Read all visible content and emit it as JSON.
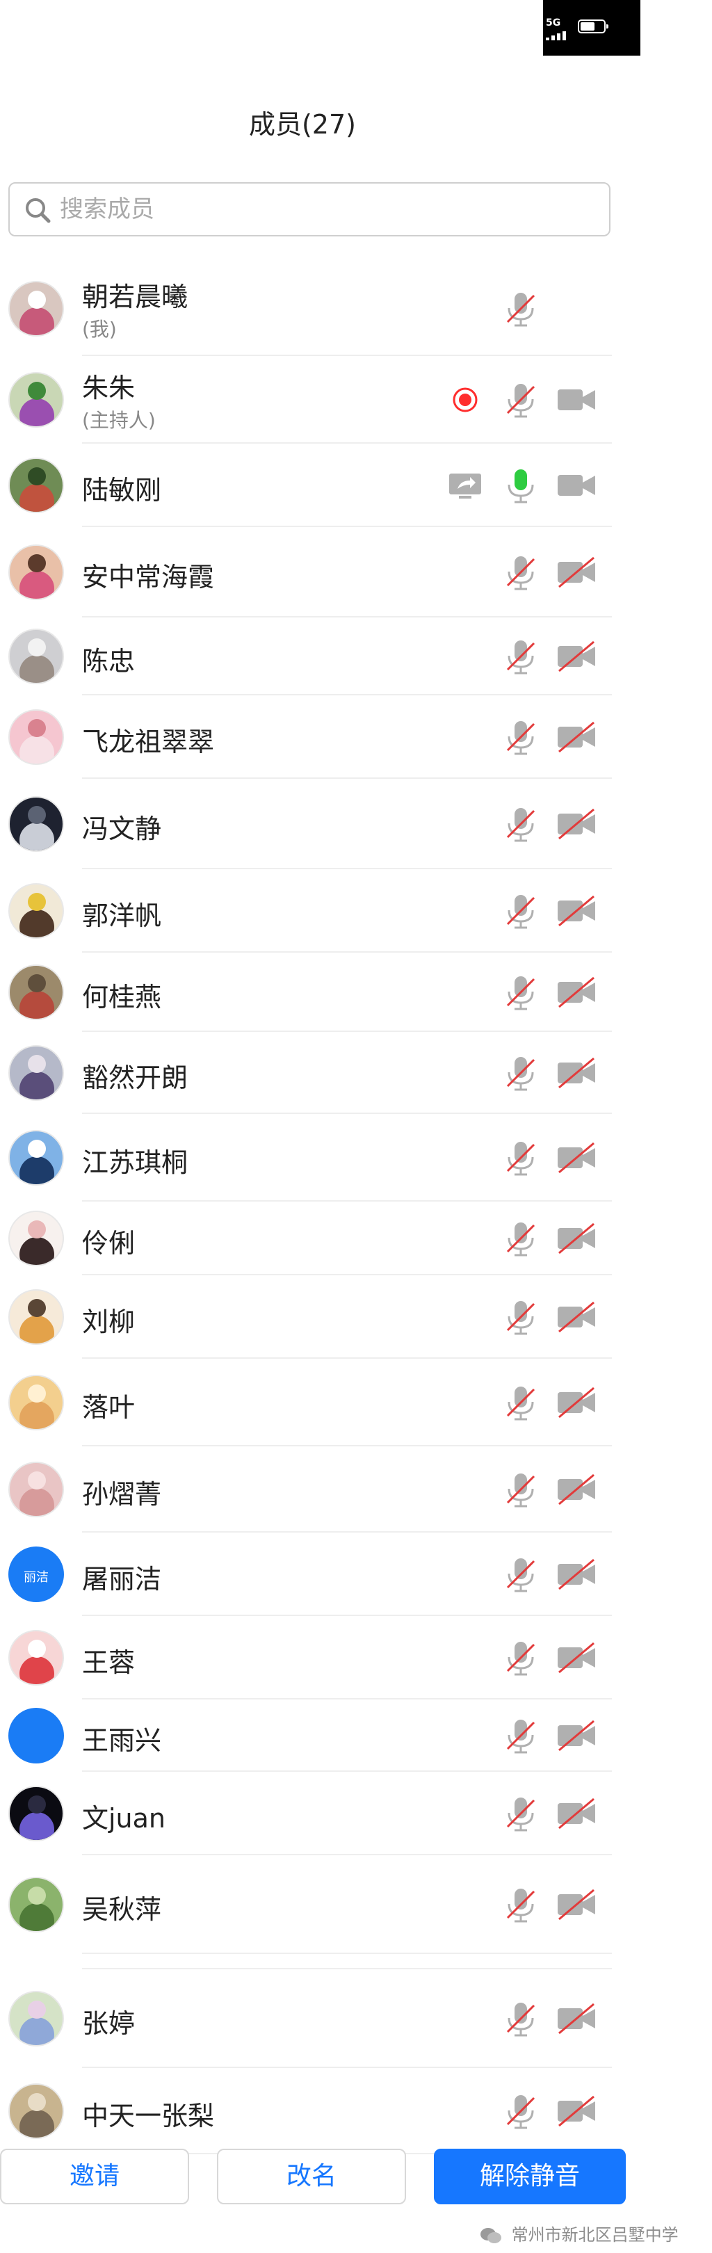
{
  "status_bar": {
    "network": "5G"
  },
  "title": "成员(27)",
  "search": {
    "placeholder": "搜索成员",
    "value": ""
  },
  "members": [
    {
      "name": "朝若晨曦",
      "role": "(我)",
      "mic": "muted",
      "cam": "none",
      "record": false,
      "share": false,
      "avatar": "photo"
    },
    {
      "name": "朱朱",
      "role": "(主持人)",
      "mic": "muted",
      "cam": "on",
      "record": true,
      "share": false,
      "avatar": "photo"
    },
    {
      "name": "陆敏刚",
      "role": "",
      "mic": "active",
      "cam": "on",
      "record": false,
      "share": true,
      "avatar": "photo"
    },
    {
      "name": "安中常海霞",
      "role": "",
      "mic": "muted",
      "cam": "off",
      "record": false,
      "share": false,
      "avatar": "photo"
    },
    {
      "name": "陈忠",
      "role": "",
      "mic": "muted",
      "cam": "off",
      "record": false,
      "share": false,
      "avatar": "photo"
    },
    {
      "name": "飞龙祖翠翠",
      "role": "",
      "mic": "muted",
      "cam": "off",
      "record": false,
      "share": false,
      "avatar": "photo"
    },
    {
      "name": "冯文静",
      "role": "",
      "mic": "muted",
      "cam": "off",
      "record": false,
      "share": false,
      "avatar": "photo"
    },
    {
      "name": "郭洋帆",
      "role": "",
      "mic": "muted",
      "cam": "off",
      "record": false,
      "share": false,
      "avatar": "photo"
    },
    {
      "name": "何桂燕",
      "role": "",
      "mic": "muted",
      "cam": "off",
      "record": false,
      "share": false,
      "avatar": "photo"
    },
    {
      "name": "豁然开朗",
      "role": "",
      "mic": "muted",
      "cam": "off",
      "record": false,
      "share": false,
      "avatar": "photo"
    },
    {
      "name": "江苏琪桐",
      "role": "",
      "mic": "muted",
      "cam": "off",
      "record": false,
      "share": false,
      "avatar": "photo"
    },
    {
      "name": "伶俐",
      "role": "",
      "mic": "muted",
      "cam": "off",
      "record": false,
      "share": false,
      "avatar": "photo"
    },
    {
      "name": "刘柳",
      "role": "",
      "mic": "muted",
      "cam": "off",
      "record": false,
      "share": false,
      "avatar": "photo"
    },
    {
      "name": "落叶",
      "role": "",
      "mic": "muted",
      "cam": "off",
      "record": false,
      "share": false,
      "avatar": "photo"
    },
    {
      "name": "孙熠菁",
      "role": "",
      "mic": "muted",
      "cam": "off",
      "record": false,
      "share": false,
      "avatar": "photo"
    },
    {
      "name": "屠丽洁",
      "role": "",
      "mic": "muted",
      "cam": "off",
      "record": false,
      "share": false,
      "avatar": "text",
      "avatar_text": "丽洁"
    },
    {
      "name": "王蓉",
      "role": "",
      "mic": "muted",
      "cam": "off",
      "record": false,
      "share": false,
      "avatar": "photo"
    },
    {
      "name": "王雨兴",
      "role": "",
      "mic": "muted",
      "cam": "off",
      "record": false,
      "share": false,
      "avatar": "blue"
    },
    {
      "name": "文juan",
      "role": "",
      "mic": "muted",
      "cam": "off",
      "record": false,
      "share": false,
      "avatar": "photo"
    },
    {
      "name": "吴秋萍",
      "role": "",
      "mic": "muted",
      "cam": "off",
      "record": false,
      "share": false,
      "avatar": "photo"
    },
    {
      "name": "",
      "role": "",
      "mic": "none",
      "cam": "none",
      "record": false,
      "share": false,
      "avatar": "photo"
    },
    {
      "name": "张婷",
      "role": "",
      "mic": "muted",
      "cam": "off",
      "record": false,
      "share": false,
      "avatar": "photo"
    },
    {
      "name": "中天一张梨",
      "role": "",
      "mic": "muted",
      "cam": "off",
      "record": false,
      "share": false,
      "avatar": "photo"
    }
  ],
  "buttons": {
    "invite": "邀请",
    "rename": "改名",
    "unmute": "解除静音"
  },
  "watermark": "常州市新北区吕墅中学",
  "colors": {
    "accent": "#1677ff",
    "mic_active": "#2ecc40",
    "record": "#ff2d2d",
    "icon_gray": "#b0b0b0",
    "slash_red": "#e23b3b"
  }
}
